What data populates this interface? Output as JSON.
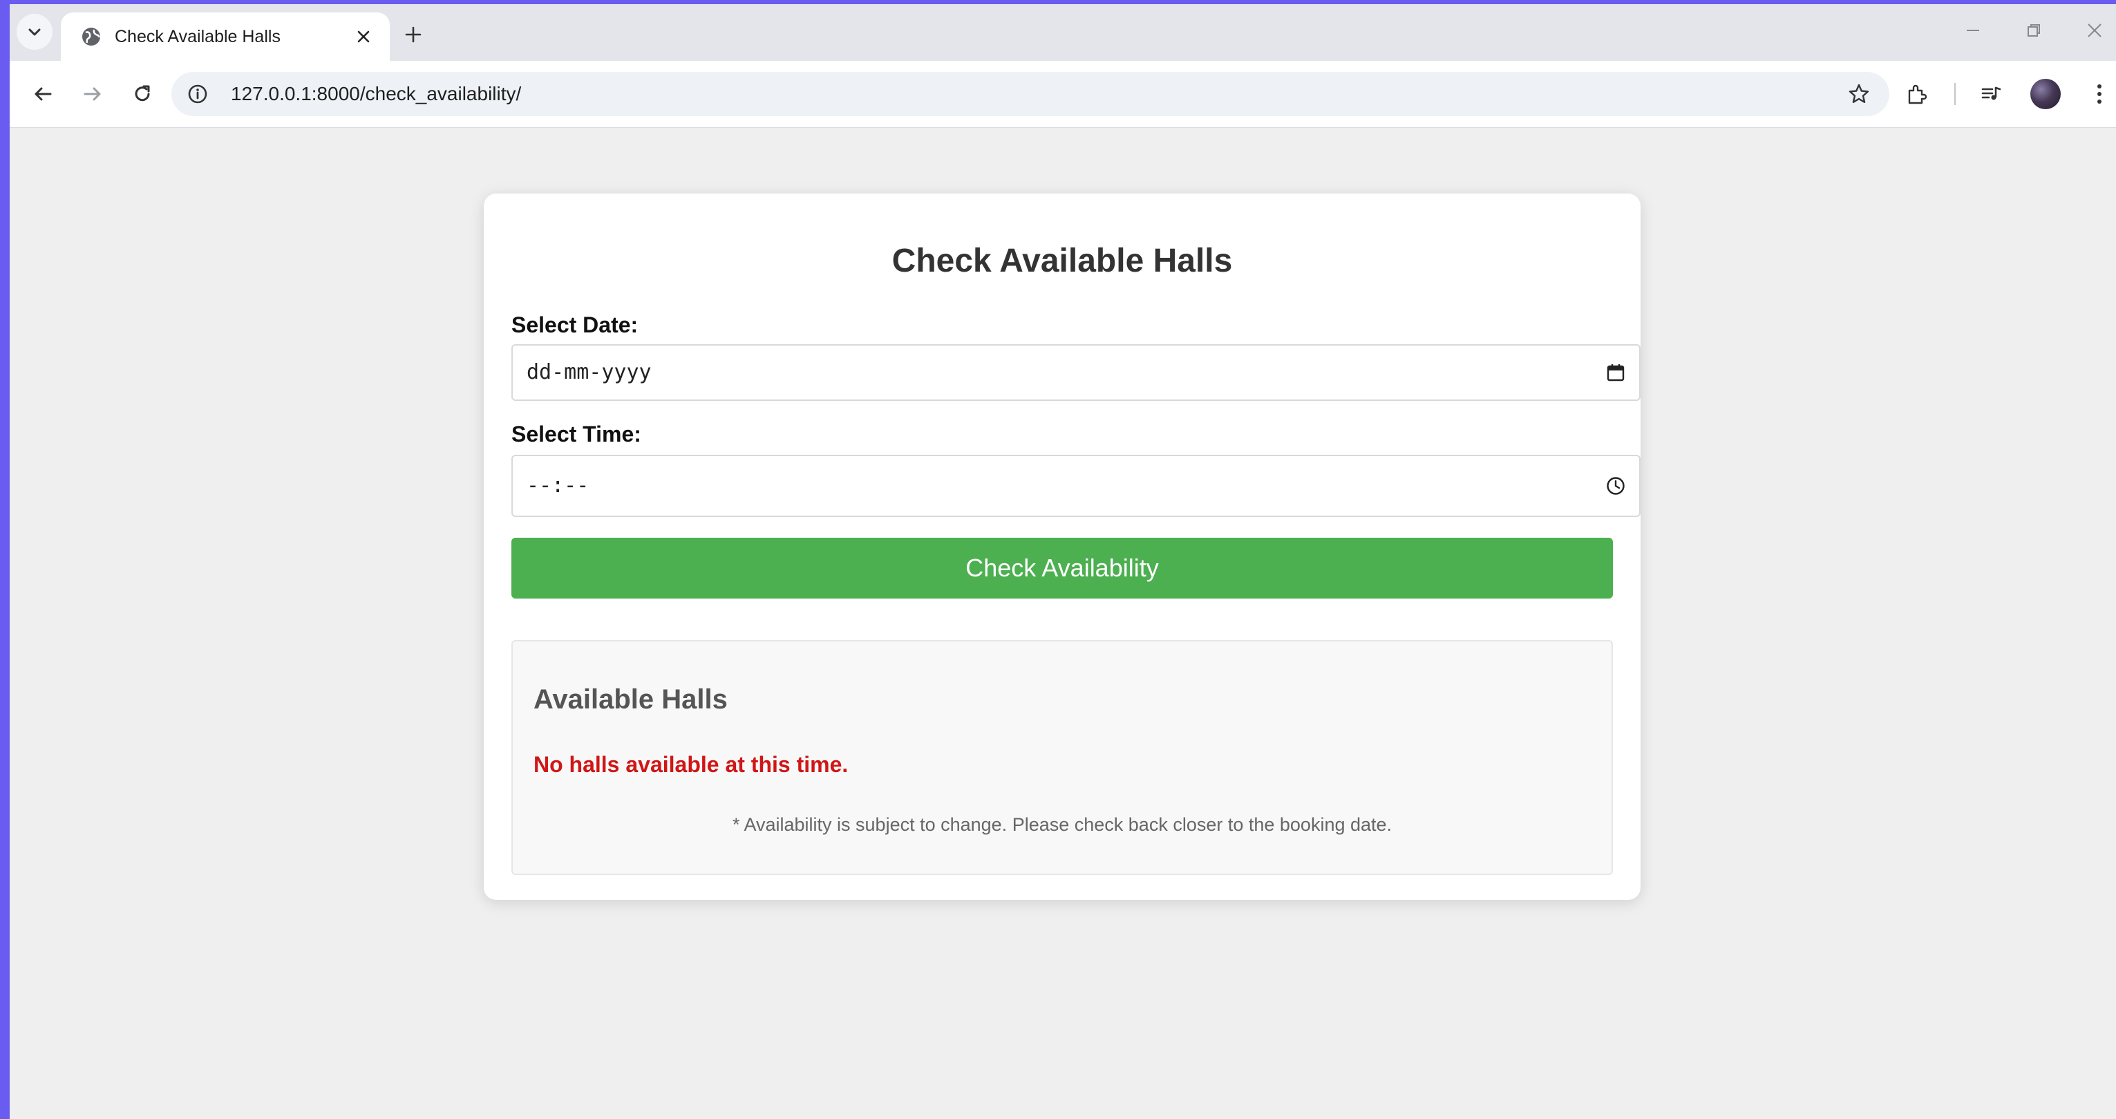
{
  "browser": {
    "tab_title": "Check Available Halls",
    "url": "127.0.0.1:8000/check_availability/"
  },
  "page": {
    "title": "Check Available Halls",
    "date_label": "Select Date:",
    "date_value": "dd-mm-yyyy",
    "time_label": "Select Time:",
    "time_value": "--:--",
    "submit_label": "Check Availability",
    "results_title": "Available Halls",
    "no_results": "No halls available at this time.",
    "note": "* Availability is subject to change. Please check back closer to the booking date."
  },
  "colors": {
    "button": "#4caf50",
    "error_text": "#d01616",
    "desktop_background": "#6a5cf0"
  },
  "icons": [
    "tab-search-icon",
    "globe-icon",
    "close-icon",
    "plus-icon",
    "minimize-icon",
    "restore-icon",
    "window-close-icon",
    "back-icon",
    "forward-icon",
    "reload-icon",
    "site-info-icon",
    "star-icon",
    "extensions-icon",
    "media-queue-icon",
    "avatar",
    "more-icon",
    "calendar-icon",
    "clock-icon"
  ]
}
